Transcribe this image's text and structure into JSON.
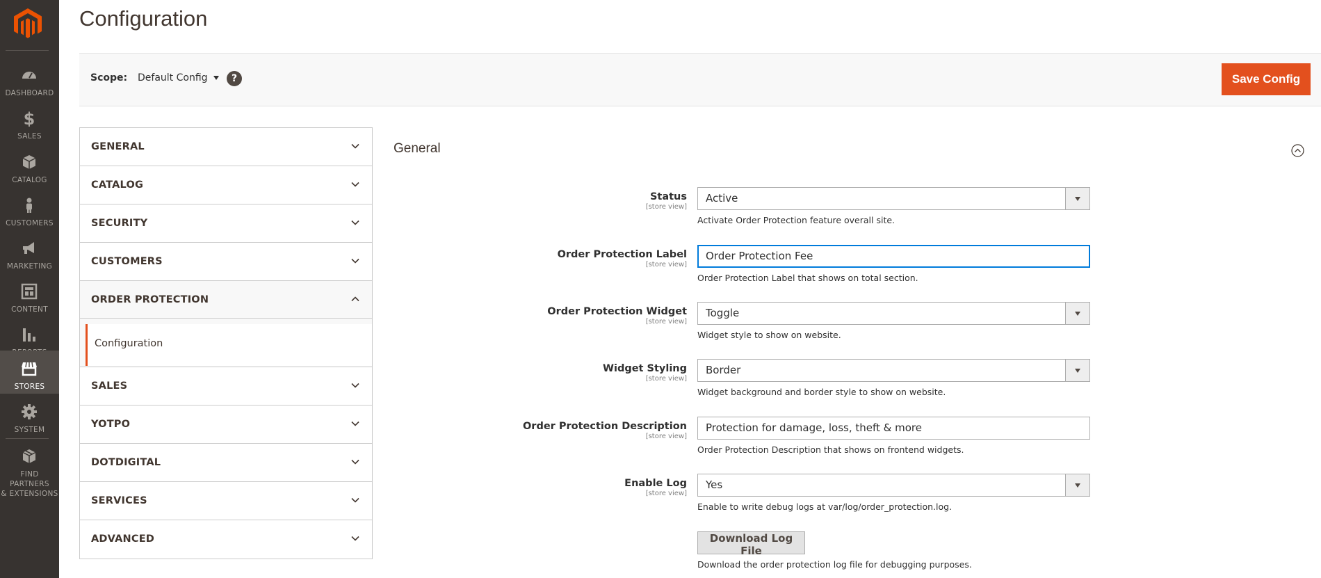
{
  "nav": {
    "items": [
      {
        "label": "DASHBOARD",
        "icon": "dashboard-icon"
      },
      {
        "label": "SALES",
        "icon": "dollar-icon"
      },
      {
        "label": "CATALOG",
        "icon": "box-icon"
      },
      {
        "label": "CUSTOMERS",
        "icon": "person-icon"
      },
      {
        "label": "MARKETING",
        "icon": "megaphone-icon"
      },
      {
        "label": "CONTENT",
        "icon": "content-icon"
      },
      {
        "label": "REPORTS",
        "icon": "bar-chart-icon"
      },
      {
        "label": "STORES",
        "icon": "store-icon"
      },
      {
        "label": "SYSTEM",
        "icon": "gear-icon"
      },
      {
        "label_line1": "FIND PARTNERS",
        "label_line2": "& EXTENSIONS",
        "icon": "extensions-icon"
      }
    ],
    "active": "STORES"
  },
  "page": {
    "title": "Configuration"
  },
  "scope": {
    "label": "Scope:",
    "value": "Default Config",
    "help": "?"
  },
  "actions": {
    "save_label": "Save Config"
  },
  "tabs": [
    {
      "label": "GENERAL"
    },
    {
      "label": "CATALOG"
    },
    {
      "label": "SECURITY"
    },
    {
      "label": "CUSTOMERS"
    },
    {
      "label": "ORDER PROTECTION",
      "open": true,
      "subitems": [
        {
          "label": "Configuration",
          "active": true
        }
      ]
    },
    {
      "label": "SALES"
    },
    {
      "label": "YOTPO"
    },
    {
      "label": "DOTDIGITAL"
    },
    {
      "label": "SERVICES"
    },
    {
      "label": "ADVANCED"
    }
  ],
  "section": {
    "title": "General",
    "fields": [
      {
        "label": "Status",
        "scope": "[store view]",
        "type": "select",
        "value": "Active",
        "note": "Activate Order Protection feature overall site."
      },
      {
        "label": "Order Protection Label",
        "scope": "[store view]",
        "type": "text",
        "value": "Order Protection Fee",
        "note": "Order Protection Label that shows on total section."
      },
      {
        "label": "Order Protection Widget",
        "scope": "[store view]",
        "type": "select",
        "value": "Toggle",
        "note": "Widget style to show on website."
      },
      {
        "label": "Widget Styling",
        "scope": "[store view]",
        "type": "select",
        "value": "Border",
        "note": "Widget background and border style to show on website."
      },
      {
        "label": "Order Protection Description",
        "scope": "[store view]",
        "type": "text",
        "value": "Protection for damage, loss, theft & more",
        "note": "Order Protection Description that shows on frontend widgets."
      },
      {
        "label": "Enable Log",
        "scope": "[store view]",
        "type": "select",
        "value": "Yes",
        "note": "Enable to write debug logs at var/log/order_protection.log."
      }
    ],
    "download": {
      "label": "Download Log File",
      "note": "Download the order protection log file for debugging purposes."
    }
  },
  "colors": {
    "sidebar": "#373330",
    "sidebar_active": "#524d49",
    "accent": "#e3501e",
    "focus": "#007bdb"
  }
}
